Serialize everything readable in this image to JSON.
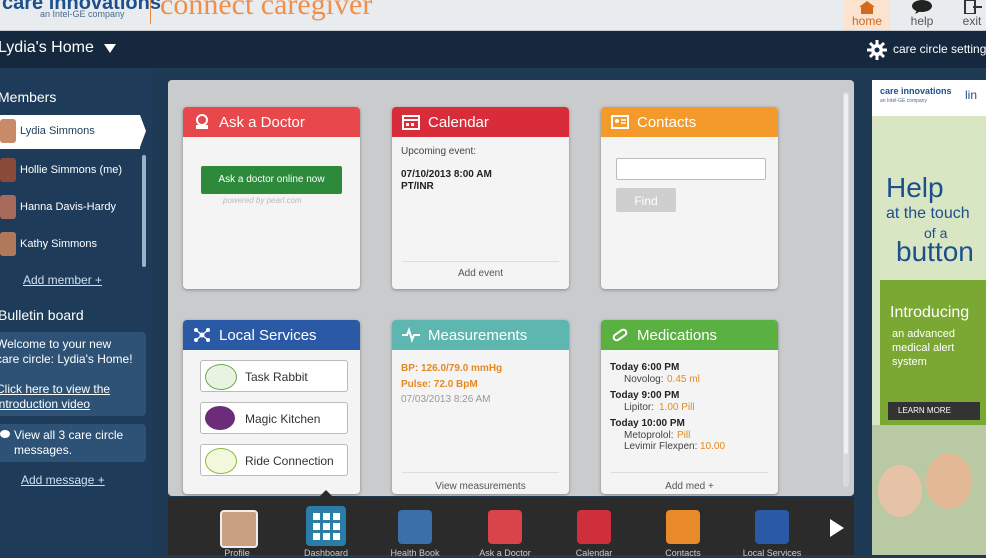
{
  "header": {
    "logo_text": "care innovations",
    "logo_sub": "an Intel-GE company",
    "app_title": "connect caregiver",
    "nav": [
      {
        "label": "home",
        "icon": "home-icon"
      },
      {
        "label": "help",
        "icon": "help-chat-icon"
      },
      {
        "label": "exit",
        "icon": "exit-icon"
      }
    ]
  },
  "subbar": {
    "home_title": "Lydia's Home",
    "settings_label": "care circle settings"
  },
  "sidebar": {
    "members_heading": "Members",
    "members": [
      {
        "name": "Lydia Simmons",
        "avatar_color": "#c98a6a"
      },
      {
        "name": "Hollie Simmons (me)",
        "avatar_color": "#8a4a3a"
      },
      {
        "name": "Hanna Davis-Hardy",
        "avatar_color": "#a86a5a"
      },
      {
        "name": "Kathy Simmons",
        "avatar_color": "#b07a5a"
      }
    ],
    "add_member": "Add member +",
    "bulletin_heading": "Bulletin board",
    "bulletin_welcome": [
      "Welcome to your new",
      "care circle: Lydia's Home!"
    ],
    "bulletin_intro": [
      "Click here to view the",
      "introduction video"
    ],
    "view_all": [
      "View all 3 care circle",
      "messages."
    ],
    "add_message": "Add message +"
  },
  "cards": {
    "ask_doctor": {
      "title": "Ask a Doctor",
      "color": "#e8474c",
      "button": "Ask a doctor online now",
      "powered": "powered by pearl.com"
    },
    "calendar": {
      "title": "Calendar",
      "color": "#d92c3a",
      "upcoming": "Upcoming event:",
      "event_date": "07/10/2013 8:00 AM",
      "event_name": "PT/INR",
      "add_event": "Add event"
    },
    "contacts": {
      "title": "Contacts",
      "color": "#f39a2a",
      "search_value": "",
      "find_button": "Find"
    },
    "local_services": {
      "title": "Local Services",
      "color": "#2a5aa6",
      "services": [
        {
          "name": "Task Rabbit",
          "logo": "task-rabbit-logo"
        },
        {
          "name": "Magic Kitchen",
          "logo": "magic-kitchen-logo"
        },
        {
          "name": "Ride Connection",
          "logo": "ride-connection-logo"
        }
      ]
    },
    "measurements": {
      "title": "Measurements",
      "color": "#5db7b0",
      "bp": "BP: 126.0/79.0 mmHg",
      "pulse": "Pulse: 72.0 BpM",
      "date": "07/03/2013 8:26 AM",
      "view": "View measurements"
    },
    "medications": {
      "title": "Medications",
      "color": "#5ab040",
      "entries": [
        {
          "time": "Today 6:00 PM",
          "meds": [
            {
              "name": "Novolog:",
              "dose": "0.45 ml"
            }
          ]
        },
        {
          "time": "Today 9:00 PM",
          "meds": [
            {
              "name": "Lipitor:",
              "dose": "1.00 Pill"
            }
          ]
        },
        {
          "time": "Today 10:00 PM",
          "meds": [
            {
              "name": "Metoprolol:",
              "dose": "Pill"
            },
            {
              "name": "Levimir Flexpen:",
              "dose": "10.00"
            }
          ]
        }
      ],
      "add_med": "Add med +"
    }
  },
  "dock": [
    {
      "label": "Profile",
      "color": "#c9a080",
      "icon": "profile-icon"
    },
    {
      "label": "Dashboard",
      "color": "#2a7da6",
      "icon": "dashboard-grid-icon"
    },
    {
      "label": "Health Book",
      "color": "#3a6fa8",
      "icon": "health-book-icon"
    },
    {
      "label": "Ask a Doctor",
      "color": "#d9434a",
      "icon": "ask-doctor-icon"
    },
    {
      "label": "Calendar",
      "color": "#cf2f3a",
      "icon": "calendar-icon"
    },
    {
      "label": "Contacts",
      "color": "#e98a2a",
      "icon": "contacts-icon"
    },
    {
      "label": "Local Services",
      "color": "#2a5aa6",
      "icon": "local-services-icon"
    }
  ],
  "ad": {
    "brand": "care innovations",
    "brand_sub": "an Intel-GE company",
    "brand_suffix": "lin",
    "headline": [
      "Help",
      "at the touch",
      "of a",
      "button"
    ],
    "introducing": "Introducing",
    "desc": [
      "an advanced",
      "medical alert",
      "system"
    ],
    "learn_more": "LEARN MORE"
  }
}
